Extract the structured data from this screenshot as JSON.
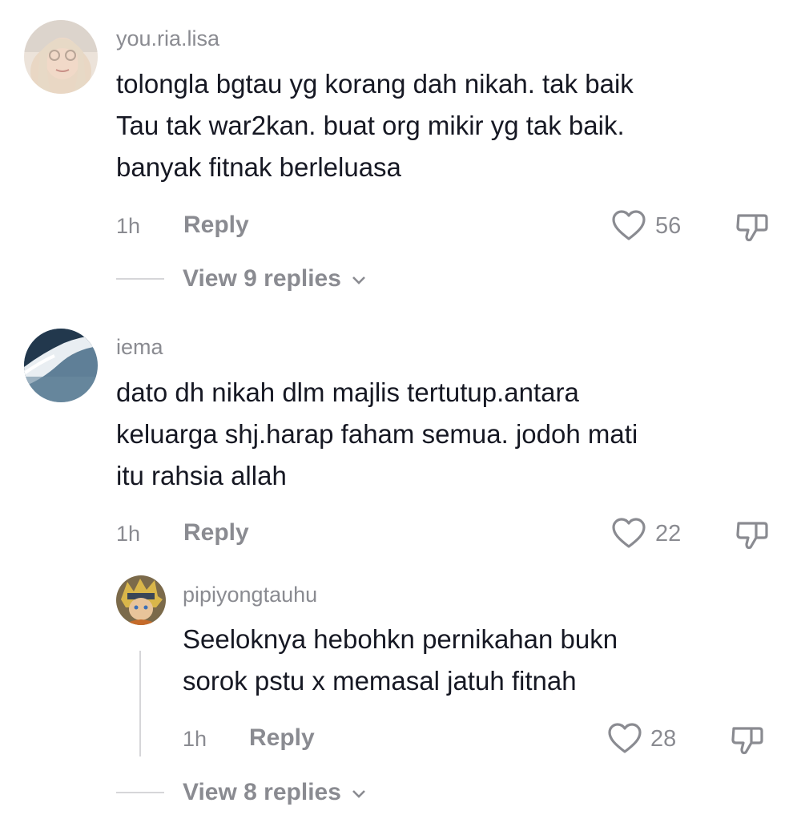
{
  "comments": [
    {
      "username": "you.ria.lisa",
      "text_lines": [
        "tolongla bgtau yg korang dah nikah. tak baik",
        "Tau tak war2kan. buat org mikir yg tak baik.",
        "banyak fitnak berleluasa"
      ],
      "time": "1h",
      "reply_label": "Reply",
      "likes": "56",
      "view_replies": "View 9 replies"
    },
    {
      "username": "iema",
      "text_lines": [
        "dato dh nikah dlm majlis tertutup.antara",
        "keluarga shj.harap faham semua. jodoh mati",
        "itu rahsia allah"
      ],
      "time": "1h",
      "reply_label": "Reply",
      "likes": "22"
    }
  ],
  "reply": {
    "username": "pipiyongtauhu",
    "text_lines": [
      "Seeloknya hebohkn pernikahan bukn",
      "sorok pstu x memasal jatuh fitnah"
    ],
    "time": "1h",
    "reply_label": "Reply",
    "likes": "28",
    "view_replies": "View 8 replies"
  },
  "icons": [
    "heart-icon",
    "dislike-icon",
    "chevron-down-icon"
  ]
}
